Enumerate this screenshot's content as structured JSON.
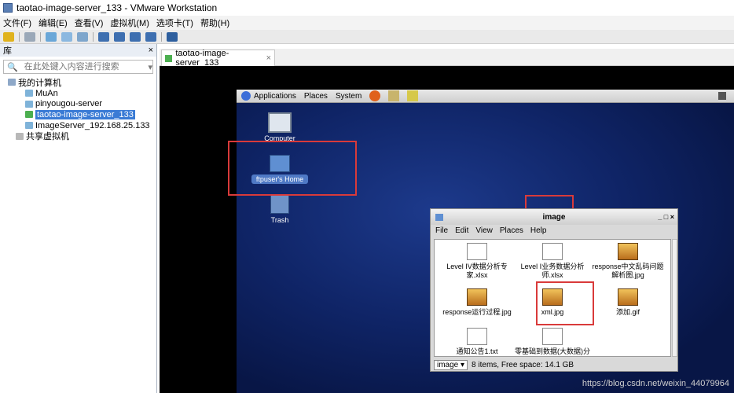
{
  "window": {
    "title": "taotao-image-server_133 - VMware Workstation"
  },
  "menu": [
    "文件(F)",
    "编辑(E)",
    "查看(V)",
    "虚拟机(M)",
    "选项卡(T)",
    "帮助(H)"
  ],
  "library": {
    "title": "库",
    "close": "×",
    "search_placeholder": "在此处键入内容进行搜索",
    "tree": [
      {
        "label": "我的计算机",
        "level": 0
      },
      {
        "label": "MuAn",
        "level": 1
      },
      {
        "label": "pinyougou-server",
        "level": 1
      },
      {
        "label": "taotao-image-server_133",
        "level": 1,
        "selected": true
      },
      {
        "label": "ImageServer_192.168.25.133",
        "level": 1
      },
      {
        "label": "共享虚拟机",
        "level": 0
      }
    ]
  },
  "tab": {
    "label": "taotao-image-server_133",
    "close": "×"
  },
  "guest": {
    "panel": [
      "Applications",
      "Places",
      "System"
    ],
    "desktop_icons": [
      {
        "label": "Computer"
      },
      {
        "label": "ftpuser's Home"
      },
      {
        "label": "Trash"
      }
    ],
    "file_manager": {
      "title": "image",
      "controls": "_ □ ×",
      "menu": [
        "File",
        "Edit",
        "View",
        "Places",
        "Help"
      ],
      "files": [
        {
          "name": "Level IV数据分析专家.xlsx",
          "type": "doc"
        },
        {
          "name": "Level Ⅰ业务数据分析师.xlsx",
          "type": "doc"
        },
        {
          "name": "response中文乱码问题解析图.jpg",
          "type": "jpg"
        },
        {
          "name": "response运行过程.jpg",
          "type": "jpg"
        },
        {
          "name": "xml.jpg",
          "type": "jpg"
        },
        {
          "name": "添加.gif",
          "type": "jpg"
        },
        {
          "name": "通知公告1.txt",
          "type": "doc"
        },
        {
          "name": "零基础到数据(大数据)分析专家-首席分析师",
          "type": "doc"
        }
      ],
      "status_location": "image ▾",
      "status_text": "8 items, Free space: 14.1 GB"
    }
  },
  "watermark": "https://blog.csdn.net/weixin_44079964"
}
